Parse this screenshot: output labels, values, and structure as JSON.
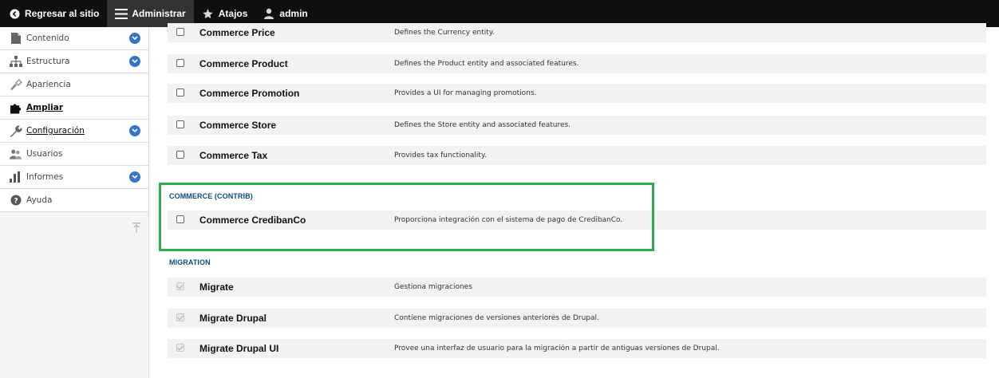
{
  "toolbar": {
    "back_label": "Regresar al sitio",
    "admin_label": "Administrar",
    "shortcuts_label": "Atajos",
    "user_label": "admin"
  },
  "sidebar": {
    "items": [
      {
        "label": "Contenido",
        "icon": "file-icon",
        "expandable": true
      },
      {
        "label": "Estructura",
        "icon": "sitemap-icon",
        "expandable": true
      },
      {
        "label": "Apariencia",
        "icon": "brush-icon",
        "expandable": false
      },
      {
        "label": "Ampliar",
        "icon": "puzzle-icon",
        "expandable": false,
        "active": true
      },
      {
        "label": "Configuración",
        "icon": "wrench-icon",
        "expandable": true
      },
      {
        "label": "Usuarios",
        "icon": "users-icon",
        "expandable": false
      },
      {
        "label": "Informes",
        "icon": "bar-chart-icon",
        "expandable": true
      },
      {
        "label": "Ayuda",
        "icon": "help-icon",
        "expandable": false
      }
    ]
  },
  "modules": {
    "commerce_rows": [
      {
        "name": "Commerce Price",
        "desc": "Defines the Currency entity."
      },
      {
        "name": "Commerce Product",
        "desc": "Defines the Product entity and associated features."
      },
      {
        "name": "Commerce Promotion",
        "desc": "Provides a UI for managing promotions."
      },
      {
        "name": "Commerce Store",
        "desc": "Defines the Store entity and associated features."
      },
      {
        "name": "Commerce Tax",
        "desc": "Provides tax functionality."
      }
    ],
    "contrib_title": "COMMERCE (CONTRIB)",
    "contrib_rows": [
      {
        "name": "Commerce CredibanCo",
        "desc": "Proporciona integración con el sistema de pago de CredibanCo."
      }
    ],
    "migration_title": "MIGRATION",
    "migration_rows": [
      {
        "name": "Migrate",
        "desc": "Gestiona migraciones"
      },
      {
        "name": "Migrate Drupal",
        "desc": "Contiene migraciones de versiones anteriores de Drupal."
      },
      {
        "name": "Migrate Drupal UI",
        "desc": "Provee una interfaz de usuario para la migración a partir de antiguas versiones de Drupal."
      }
    ]
  },
  "colors": {
    "highlight": "#2daa4a",
    "group_title": "#0d4a7f",
    "toolbar_bg": "#0f0f0f",
    "chevron": "#3476c2"
  }
}
